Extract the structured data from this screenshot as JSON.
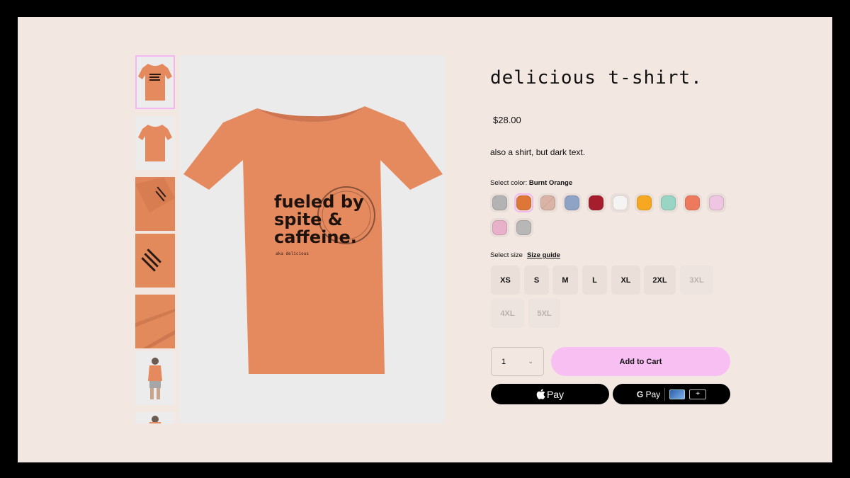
{
  "product": {
    "title": "delicious t-shirt.",
    "price": "$28.00",
    "description": "also a shirt, but dark text.",
    "shirt_text": {
      "line1": "fueled by",
      "line2": "spite &",
      "line3": "caffeine.",
      "small": "aka delicious"
    }
  },
  "gallery": {
    "thumbnails": [
      {
        "name": "front",
        "active": true
      },
      {
        "name": "front-plain",
        "active": false
      },
      {
        "name": "sleeve",
        "active": false
      },
      {
        "name": "print-closeup",
        "active": false
      },
      {
        "name": "fabric-detail",
        "active": false
      },
      {
        "name": "model",
        "active": false
      },
      {
        "name": "model-2",
        "active": false
      }
    ],
    "shirt_color": "#e58a5f"
  },
  "color": {
    "label": "Select color: ",
    "selected": "Burnt Orange",
    "swatches": [
      {
        "color": "#b3b3b4",
        "selected": false
      },
      {
        "color": "#de7638",
        "selected": true
      },
      {
        "color": "#d9b4a6",
        "selected": false
      },
      {
        "color": "#8fa3c6",
        "selected": false
      },
      {
        "color": "#a61e2e",
        "selected": false
      },
      {
        "color": "#f6f4f2",
        "selected": false
      },
      {
        "color": "#f6a920",
        "selected": false
      },
      {
        "color": "#98d5c4",
        "selected": false
      },
      {
        "color": "#ee7a5d",
        "selected": false
      },
      {
        "color": "#eec6e1",
        "selected": false
      },
      {
        "color": "#e8b1ca",
        "selected": false
      },
      {
        "color": "#b6b7b6",
        "selected": false
      }
    ]
  },
  "size": {
    "label": "Select size",
    "guide_label": "Size guide",
    "options": [
      {
        "label": "XS",
        "available": true
      },
      {
        "label": "S",
        "available": true
      },
      {
        "label": "M",
        "available": true
      },
      {
        "label": "L",
        "available": true
      },
      {
        "label": "XL",
        "available": true
      },
      {
        "label": "2XL",
        "available": true
      },
      {
        "label": "3XL",
        "available": false
      },
      {
        "label": "4XL",
        "available": false
      },
      {
        "label": "5XL",
        "available": false
      }
    ]
  },
  "cart": {
    "quantity": "1",
    "add_label": "Add to Cart",
    "apple_pay_label": "Pay",
    "google_pay_label": "Pay",
    "google_pay_g": "G",
    "google_pay_plus": "+"
  }
}
